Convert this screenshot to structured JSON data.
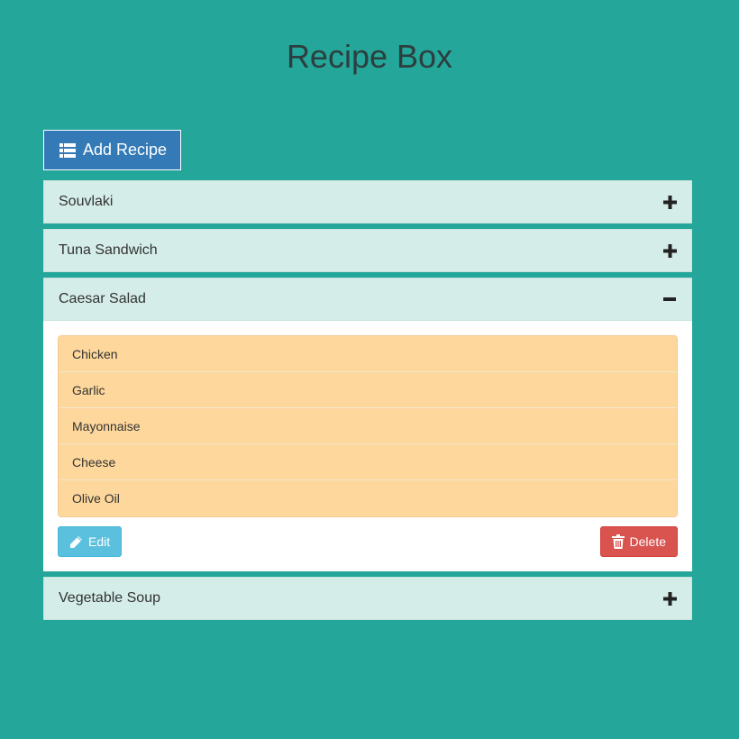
{
  "page": {
    "title": "Recipe Box"
  },
  "toolbar": {
    "add_label": "Add Recipe",
    "add_icon": "list-icon"
  },
  "recipes": [
    {
      "name": "Souvlaki",
      "expanded": false,
      "toggle_icon": "plus-icon"
    },
    {
      "name": "Tuna Sandwich",
      "expanded": false,
      "toggle_icon": "plus-icon"
    },
    {
      "name": "Caesar Salad",
      "expanded": true,
      "toggle_icon": "minus-icon",
      "ingredients": [
        "Chicken",
        "Garlic",
        "Mayonnaise",
        "Cheese",
        "Olive Oil"
      ],
      "edit_label": "Edit",
      "delete_label": "Delete"
    },
    {
      "name": "Vegetable Soup",
      "expanded": false,
      "toggle_icon": "plus-icon"
    }
  ],
  "colors": {
    "background": "#24a69a",
    "primary": "#337ab7",
    "panel_heading": "#d4ede8",
    "ingredient": "#fdd79b",
    "info": "#5bc0de",
    "danger": "#d9534f"
  }
}
